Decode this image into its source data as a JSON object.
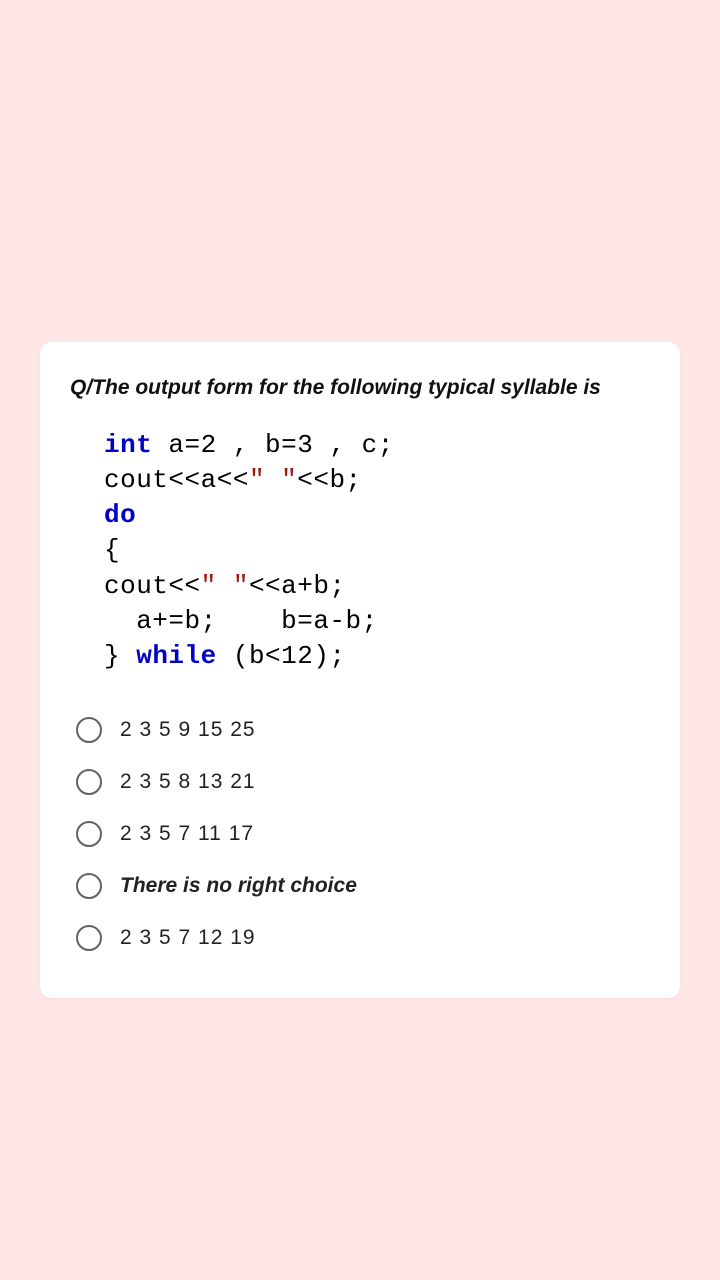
{
  "question": "Q/The output form for the following typical syllable is",
  "code": {
    "l1a": "int",
    "l1b": " a=2 , b=3 , c;",
    "l2a": "cout<<a<<",
    "l2b": "\" \"",
    "l2c": "<<b;",
    "l3": "do",
    "l4": "{",
    "l5a": "cout<<",
    "l5b": "\" \"",
    "l5c": "<<a+b;",
    "l6": "  a+=b;    b=a-b;",
    "l7a": "} ",
    "l7b": "while",
    "l7c": " (b<12);"
  },
  "options": [
    {
      "label": " 2 3 5 9 15 25",
      "italic": false
    },
    {
      "label": " 2 3 5 8 13 21",
      "italic": false
    },
    {
      "label": " 2 3 5 7 11 17",
      "italic": false
    },
    {
      "label": "There is no right choice",
      "italic": true
    },
    {
      "label": " 2 3 5 7 12 19",
      "italic": false
    }
  ]
}
